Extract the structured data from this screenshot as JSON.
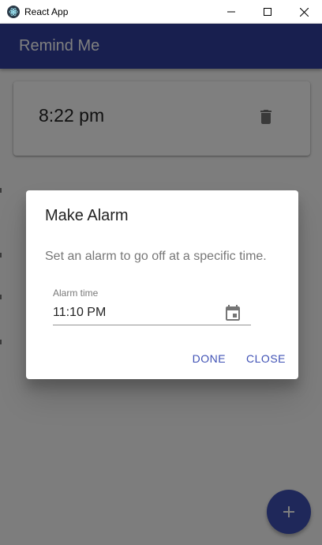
{
  "window": {
    "title": "React App",
    "controls": [
      "minimize-icon",
      "maximize-icon",
      "close-icon"
    ]
  },
  "appbar": {
    "title": "Remind Me",
    "color": "#303f9f"
  },
  "alarms": [
    {
      "time": "8:22 pm",
      "delete_icon": "trash-icon"
    }
  ],
  "fab": {
    "icon": "plus-icon",
    "color": "#3f51b5"
  },
  "dialog": {
    "title": "Make Alarm",
    "text": "Set an alarm to go off at a specific time.",
    "field": {
      "label": "Alarm time",
      "value": "11:10 PM",
      "icon": "calendar-icon"
    },
    "actions": {
      "done": "DONE",
      "close": "CLOSE"
    },
    "accent": "#3f51b5"
  }
}
